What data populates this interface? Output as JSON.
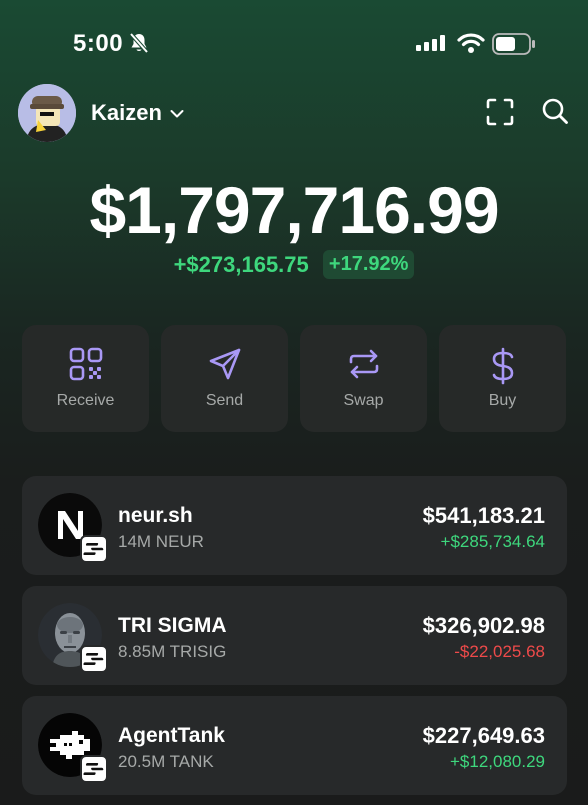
{
  "status_bar": {
    "time": "5:00",
    "icons": [
      "bell-slash-icon",
      "signal-icon",
      "wifi-icon",
      "battery-icon"
    ]
  },
  "header": {
    "account_name": "Kaizen",
    "icons": [
      "chevron-down-icon",
      "scan-icon",
      "search-icon"
    ]
  },
  "portfolio": {
    "balance": "$1,797,716.99",
    "change_amount": "+$273,165.75",
    "change_percent": "+17.92%"
  },
  "actions": [
    {
      "label": "Receive",
      "icon": "qr-code-icon"
    },
    {
      "label": "Send",
      "icon": "send-icon"
    },
    {
      "label": "Swap",
      "icon": "swap-icon"
    },
    {
      "label": "Buy",
      "icon": "dollar-icon"
    }
  ],
  "tokens": [
    {
      "name": "neur.sh",
      "amount": "14M NEUR",
      "value": "$541,183.21",
      "change": "+$285,734.64",
      "direction": "up"
    },
    {
      "name": "TRI SIGMA",
      "amount": "8.85M TRISIG",
      "value": "$326,902.98",
      "change": "-$22,025.68",
      "direction": "down"
    },
    {
      "name": "AgentTank",
      "amount": "20.5M TANK",
      "value": "$227,649.63",
      "change": "+$12,080.29",
      "direction": "up"
    }
  ],
  "colors": {
    "positive": "#3ed77d",
    "negative": "#ee4a4a",
    "accent_icon": "#a998f5",
    "card_bg": "#27292a"
  }
}
